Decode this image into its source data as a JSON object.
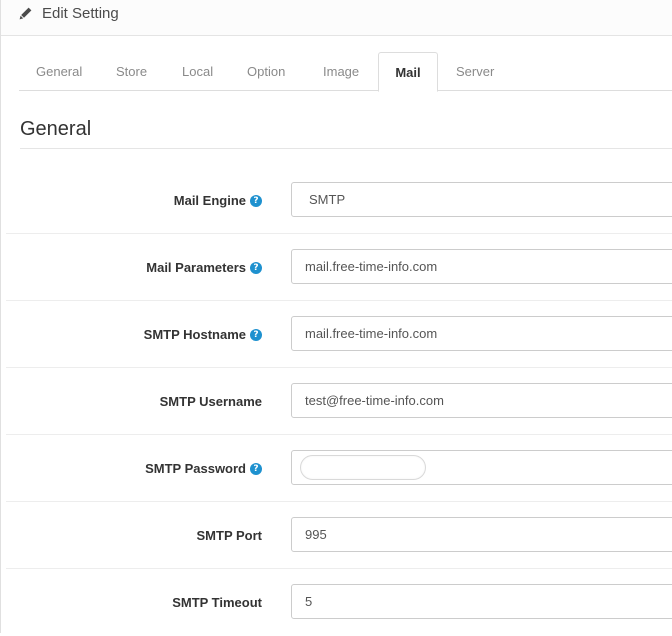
{
  "header": {
    "title": "Edit Setting",
    "icon": "pencil-icon"
  },
  "tabs": [
    {
      "label": "General"
    },
    {
      "label": "Store"
    },
    {
      "label": "Local"
    },
    {
      "label": "Option"
    },
    {
      "label": "Image"
    },
    {
      "label": "Mail",
      "active": true
    },
    {
      "label": "Server"
    }
  ],
  "section": {
    "title": "General"
  },
  "form": {
    "mail_engine": {
      "label": "Mail Engine",
      "value": "SMTP",
      "help": "?"
    },
    "mail_parameters": {
      "label": "Mail Parameters",
      "value": "mail.free-time-info.com",
      "help": "?"
    },
    "smtp_hostname": {
      "label": "SMTP Hostname",
      "value": "mail.free-time-info.com",
      "help": "?"
    },
    "smtp_username": {
      "label": "SMTP Username",
      "value": "test@free-time-info.com"
    },
    "smtp_password": {
      "label": "SMTP Password",
      "help": "?"
    },
    "smtp_port": {
      "label": "SMTP Port",
      "value": "995"
    },
    "smtp_timeout": {
      "label": "SMTP Timeout",
      "value": "5"
    }
  },
  "colors": {
    "accent": "#1e91cf",
    "border": "#cccccc"
  }
}
